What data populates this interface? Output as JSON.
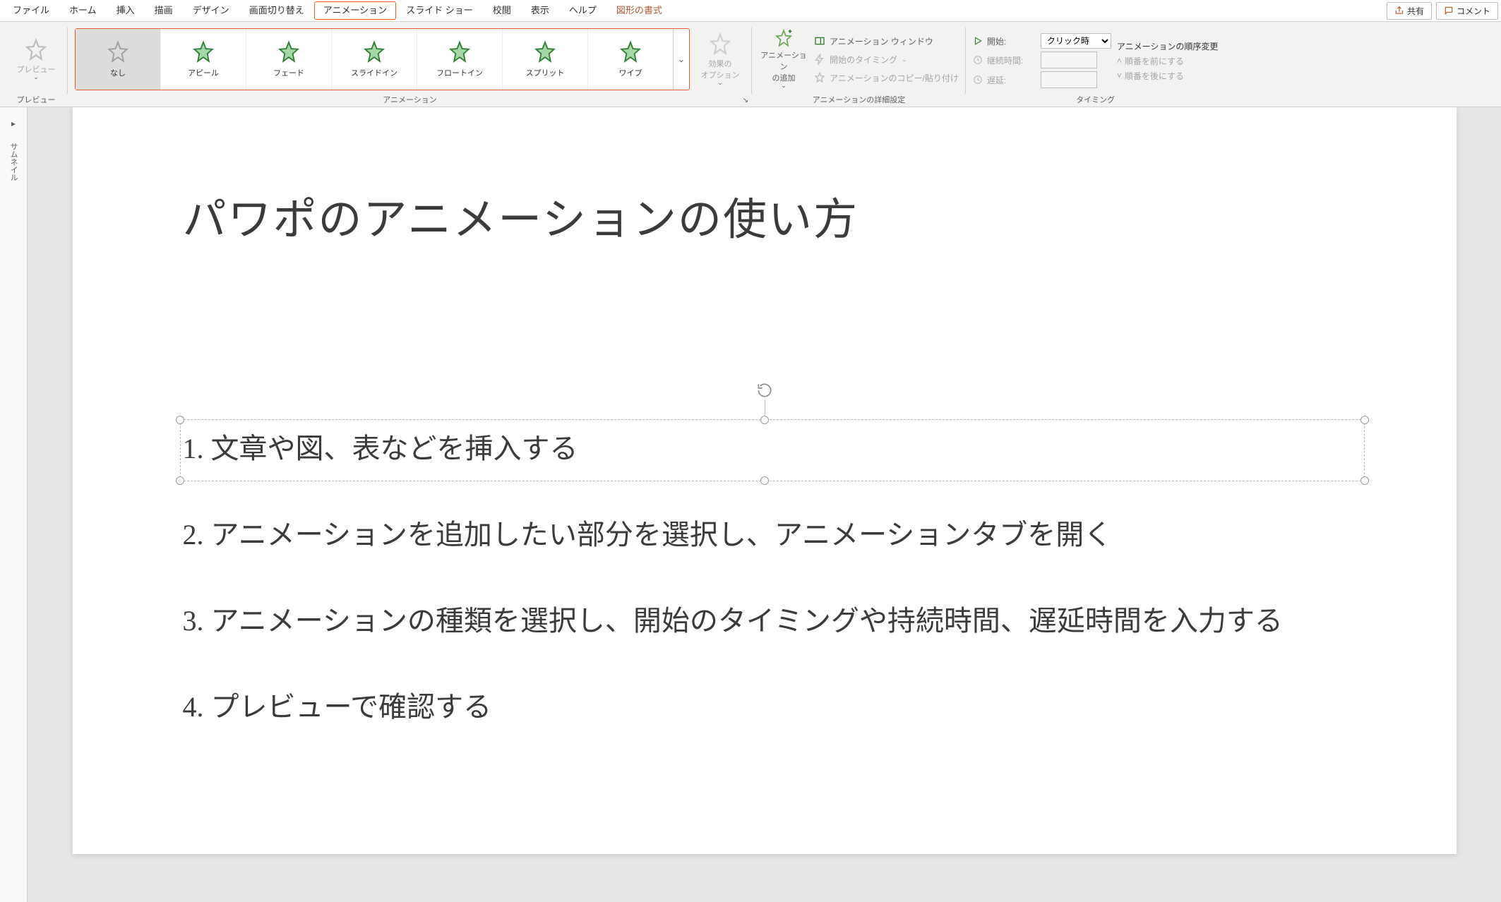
{
  "tabs": {
    "file": "ファイル",
    "home": "ホーム",
    "insert": "挿入",
    "draw": "描画",
    "design": "デザイン",
    "transitions": "画面切り替え",
    "animations": "アニメーション",
    "slideshow": "スライド ショー",
    "review": "校閲",
    "view": "表示",
    "help": "ヘルプ",
    "shape_format": "図形の書式",
    "share": "共有",
    "comments": "コメント"
  },
  "ribbon": {
    "preview_group": {
      "button": "プレビュー",
      "label": "プレビュー"
    },
    "animation_group": {
      "label": "アニメーション",
      "items": [
        {
          "id": "none",
          "label": "なし",
          "selected": true,
          "color": "gray"
        },
        {
          "id": "appear",
          "label": "アピール",
          "color": "green"
        },
        {
          "id": "fade",
          "label": "フェード",
          "color": "green"
        },
        {
          "id": "slidein",
          "label": "スライドイン",
          "color": "green"
        },
        {
          "id": "floatin",
          "label": "フロートイン",
          "color": "green"
        },
        {
          "id": "split",
          "label": "スプリット",
          "color": "green"
        },
        {
          "id": "wipe",
          "label": "ワイプ",
          "color": "green"
        }
      ],
      "effect_options": "効果の\nオプション"
    },
    "advanced_group": {
      "label": "アニメーションの詳細設定",
      "add_animation": "アニメーション\nの追加",
      "pane": "アニメーション ウィンドウ",
      "trigger": "開始のタイミング",
      "painter": "アニメーションのコピー/貼り付け"
    },
    "timing_group": {
      "label": "タイミング",
      "start_label": "開始:",
      "start_value": "クリック時",
      "duration_label": "継続時間:",
      "duration_value": "",
      "delay_label": "遅延:",
      "delay_value": "",
      "reorder_header": "アニメーションの順序変更",
      "move_earlier": "順番を前にする",
      "move_later": "順番を後にする"
    }
  },
  "thumbnails": {
    "toggle": "▸",
    "label": "サムネイル"
  },
  "slide": {
    "title": "パワポのアニメーションの使い方",
    "bullets": [
      "1.   文章や図、表などを挿入する",
      "2.   アニメーションを追加したい部分を選択し、アニメーションタブを開く",
      "3.   アニメーションの種類を選択し、開始のタイミングや持続時間、遅延時間を入力する",
      "4.   プレビューで確認する"
    ]
  }
}
